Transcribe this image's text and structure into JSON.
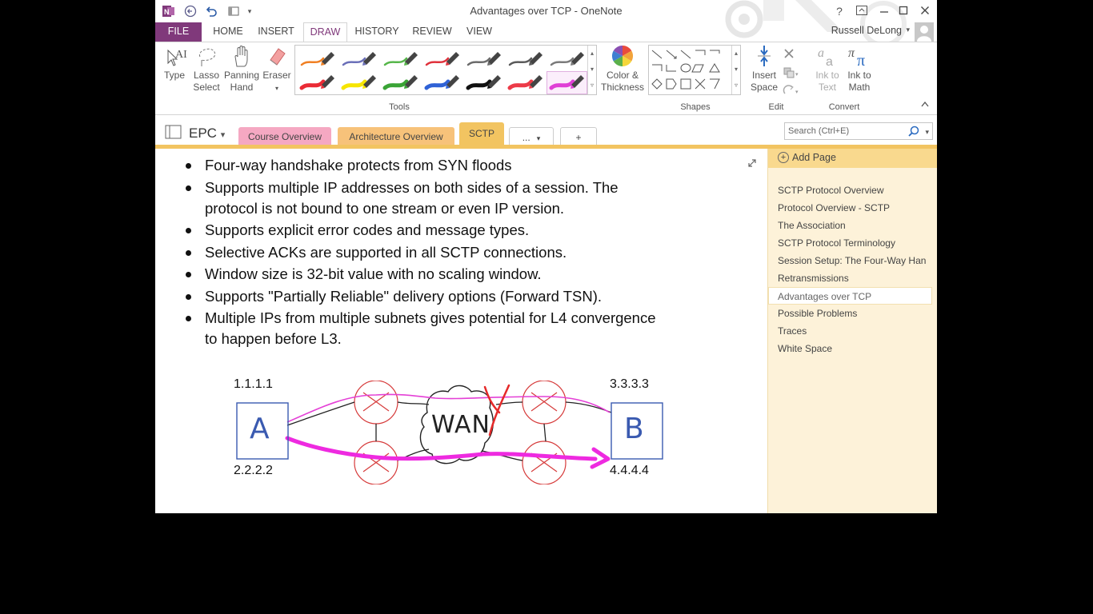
{
  "window": {
    "title": "Advantages over TCP - OneNote",
    "help_label": "?",
    "user_name": "Russell DeLong"
  },
  "ribbon_tabs": [
    "FILE",
    "HOME",
    "INSERT",
    "DRAW",
    "HISTORY",
    "REVIEW",
    "VIEW"
  ],
  "ribbon": {
    "type_label": "Type",
    "lasso_label_1": "Lasso",
    "lasso_label_2": "Select",
    "panning_label_1": "Panning",
    "panning_label_2": "Hand",
    "eraser_label": "Eraser",
    "tools_group": "Tools",
    "color_label_1": "Color &",
    "color_label_2": "Thickness",
    "shapes_group": "Shapes",
    "insert_space_1": "Insert",
    "insert_space_2": "Space",
    "edit_group": "Edit",
    "ink_text_1": "Ink to",
    "ink_text_2": "Text",
    "ink_math_1": "Ink to",
    "ink_math_2": "Math",
    "convert_group": "Convert",
    "pen_colors_row1": [
      "#f07f22",
      "#6a6fb8",
      "#56b64a",
      "#e0323c",
      "#6b6b6b",
      "#5a5a5a",
      "#7a7a7a"
    ],
    "pen_colors_row2": [
      "#ea2b35",
      "#f6e500",
      "#3aa436",
      "#2f62d6",
      "#111111",
      "#ec3a48",
      "#e040d6"
    ]
  },
  "notebook": {
    "name": "EPC",
    "sections": [
      {
        "label": "Course Overview",
        "color": "#f5a8c2"
      },
      {
        "label": "Architecture Overview",
        "color": "#f7c27a"
      },
      {
        "label": "SCTP",
        "color": "#f2c461"
      },
      {
        "label": "...",
        "color": "#ffffff"
      },
      {
        "label": "+",
        "color": "#ffffff"
      }
    ],
    "search_placeholder": "Search (Ctrl+E)"
  },
  "page": {
    "bullets": [
      "Four-way handshake protects from SYN floods",
      "Supports multiple IP addresses on both sides of a session. The protocol is not bound to one stream or even IP version.",
      "Supports explicit error codes and message types.",
      "Selective ACKs are supported in all SCTP connections.",
      "Window size is 32-bit value with no scaling window.",
      "Supports \"Partially Reliable\" delivery options (Forward TSN).",
      "Multiple IPs from multiple subnets gives potential for L4 convergence to happen before L3."
    ],
    "diagram": {
      "ip_a_top": "1.1.1.1",
      "ip_a_bottom": "2.2.2.2",
      "ip_b_top": "3.3.3.3",
      "ip_b_bottom": "4.4.4.4",
      "node_a": "A",
      "node_b": "B",
      "wan": "WAN"
    }
  },
  "page_panel": {
    "add_page": "Add Page",
    "pages": [
      "SCTP Protocol Overview",
      "Protocol Overview - SCTP",
      "The Association",
      "SCTP Protocol Terminology",
      "Session Setup: The Four-Way Han",
      "Retransmissions",
      "Advantages over TCP",
      "Possible Problems",
      "Traces",
      "White Space"
    ],
    "active_index": 6
  }
}
